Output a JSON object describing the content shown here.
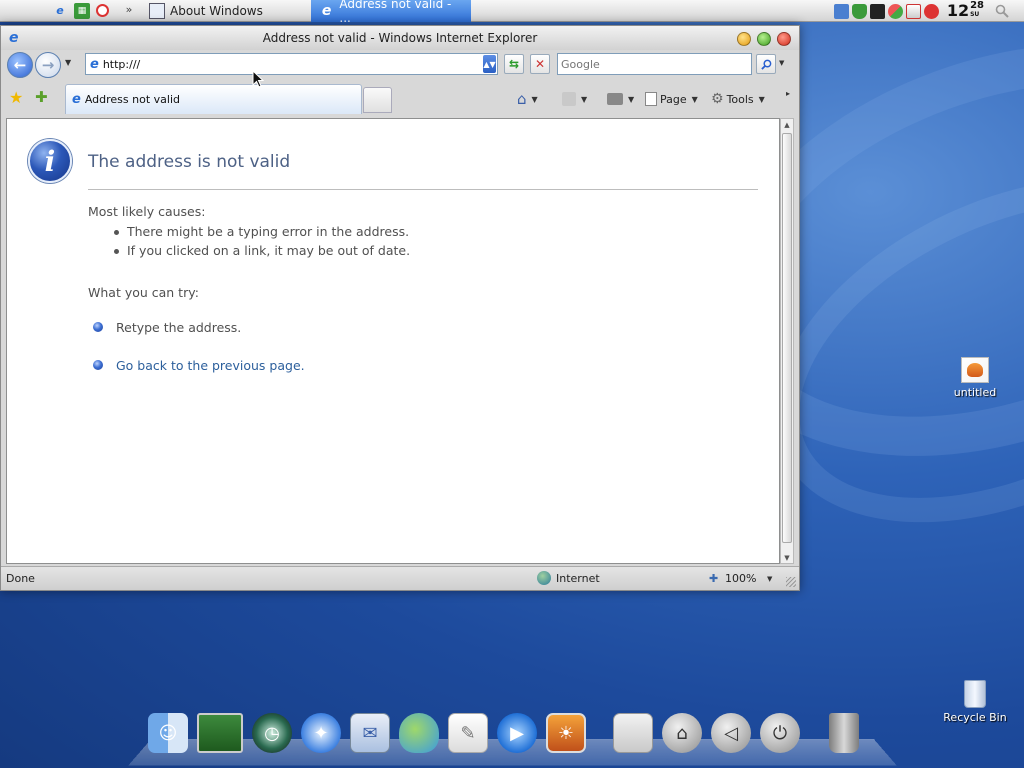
{
  "menubar": {
    "tasks": [
      {
        "label": "About Windows"
      },
      {
        "label": "Address not valid - ..."
      }
    ],
    "overflow": "»",
    "clock": {
      "hour": "12",
      "minute": "28",
      "sub": "SU"
    }
  },
  "window": {
    "title": "Address not valid - Windows Internet Explorer"
  },
  "navbar": {
    "address": "http:///",
    "search_placeholder": "Google"
  },
  "tab": {
    "label": "Address not valid"
  },
  "toolbar": {
    "page_label": "Page",
    "tools_label": "Tools"
  },
  "page": {
    "heading": "The address is not valid",
    "causes_title": "Most likely causes:",
    "causes": [
      "There might be a typing error in the address.",
      "If you clicked on a link, it may be out of date."
    ],
    "try_title": "What you can try:",
    "retype": "Retype the address.",
    "go_back": "Go back to the previous page."
  },
  "statusbar": {
    "status": "Done",
    "zone": "Internet",
    "zoom": "100%"
  },
  "desktop": {
    "icons": [
      {
        "label": "untitled"
      },
      {
        "label": "Recycle Bin"
      }
    ]
  },
  "dock": {
    "items": [
      "finder-icon",
      "photo-icon",
      "time-machine-icon",
      "safari-icon",
      "mail-icon",
      "messenger-icon",
      "notepad-icon",
      "media-player-icon",
      "iphoto-icon",
      "system-icon",
      "home-icon",
      "back-icon",
      "power-icon",
      "trash-icon"
    ]
  }
}
